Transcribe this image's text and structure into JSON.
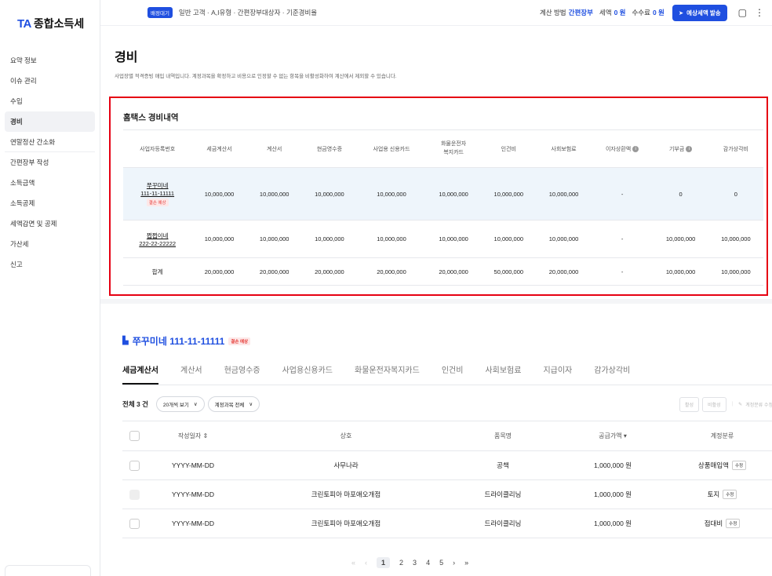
{
  "app": {
    "logo_mark": "TA",
    "logo_name": "종합소득세"
  },
  "sidebar": {
    "items": [
      {
        "label": "요약 정보"
      },
      {
        "label": "이슈 관리"
      },
      {
        "label": "수입"
      },
      {
        "label": "경비",
        "active": true
      },
      {
        "label": "연말정산 간소화"
      },
      {
        "label": "간편장부 작성"
      },
      {
        "label": "소득금액"
      },
      {
        "label": "소득공제"
      },
      {
        "label": "세액감면 및 공제"
      },
      {
        "label": "가산세"
      },
      {
        "label": "신고"
      }
    ]
  },
  "topbar": {
    "badge": "배정대기",
    "info": "일반 고객 · A,I유형 · 간편장부대상자 · 기준경비율",
    "calc_label": "계산 방법",
    "calc_value": "간편장부",
    "tax_label": "세액",
    "tax_value": "0 원",
    "fee_label": "수수료",
    "fee_value": "0 원",
    "issue_button": "예상세액 발송"
  },
  "page": {
    "title": "경비",
    "description": "사업장별 적격증빙 매입 내역입니다. 계정과목을 확정하고 비용으로 인정할 수 없는 항목을 비활성화하여 계산에서 제외할 수 있습니다."
  },
  "summary": {
    "title": "홈택스 경비내역",
    "columns": [
      "사업자등록번호",
      "세금계산서",
      "계산서",
      "현금영수증",
      "사업용 신용카드",
      "화물운전자\n복지카드",
      "인건비",
      "사회보험료",
      "이자상환액",
      "기부금",
      "감가상각비"
    ],
    "rows": [
      {
        "name": "쭈꾸미네",
        "number": "111-11-11111",
        "badge": "결손 예상",
        "cells": [
          "10,000,000",
          "10,000,000",
          "10,000,000",
          "10,000,000",
          "10,000,000",
          "10,000,000",
          "10,000,000",
          "-",
          "0",
          "0"
        ]
      },
      {
        "name": "쩝쩝이네",
        "number": "222-22-22222",
        "cells": [
          "10,000,000",
          "10,000,000",
          "10,000,000",
          "10,000,000",
          "10,000,000",
          "10,000,000",
          "10,000,000",
          "-",
          "10,000,000",
          "10,000,000"
        ]
      },
      {
        "name": "합계",
        "cells": [
          "20,000,000",
          "20,000,000",
          "20,000,000",
          "20,000,000",
          "20,000,000",
          "50,000,000",
          "20,000,000",
          "-",
          "10,000,000",
          "10,000,000"
        ]
      }
    ]
  },
  "detail": {
    "title": "쭈꾸미네 111-11-11111",
    "badge": "결손 예상",
    "tabs": [
      "세금계산서",
      "계산서",
      "현금영수증",
      "사업용신용카드",
      "화물운전자복지카드",
      "인건비",
      "사회보험료",
      "지급이자",
      "감가상각비"
    ],
    "count": "전체 3 건",
    "per_page": "20개씩 보기",
    "account_filter": "계정과목 전체",
    "btn_activate": "활성",
    "btn_deactivate": "비활성",
    "btn_edit_account": "계정분류 수정",
    "columns": [
      "작성일자 ⇕",
      "상호",
      "품목명",
      "공급가액 ▾",
      "계정분류"
    ],
    "edit_label": "수정",
    "rows": [
      {
        "date": "YYYY-MM-DD",
        "vendor": "사무나라",
        "item": "공책",
        "amount": "1,000,000 원",
        "account": "상품매입액"
      },
      {
        "date": "YYYY-MM-DD",
        "vendor": "크린토피아 마포애오개점",
        "item": "드라이클리닝",
        "amount": "1,000,000 원",
        "account": "토지"
      },
      {
        "date": "YYYY-MM-DD",
        "vendor": "크린토피아 마포애오개점",
        "item": "드라이클리닝",
        "amount": "1,000,000 원",
        "account": "접대비"
      }
    ]
  },
  "pager": {
    "pages": [
      "1",
      "2",
      "3",
      "4",
      "5"
    ]
  }
}
